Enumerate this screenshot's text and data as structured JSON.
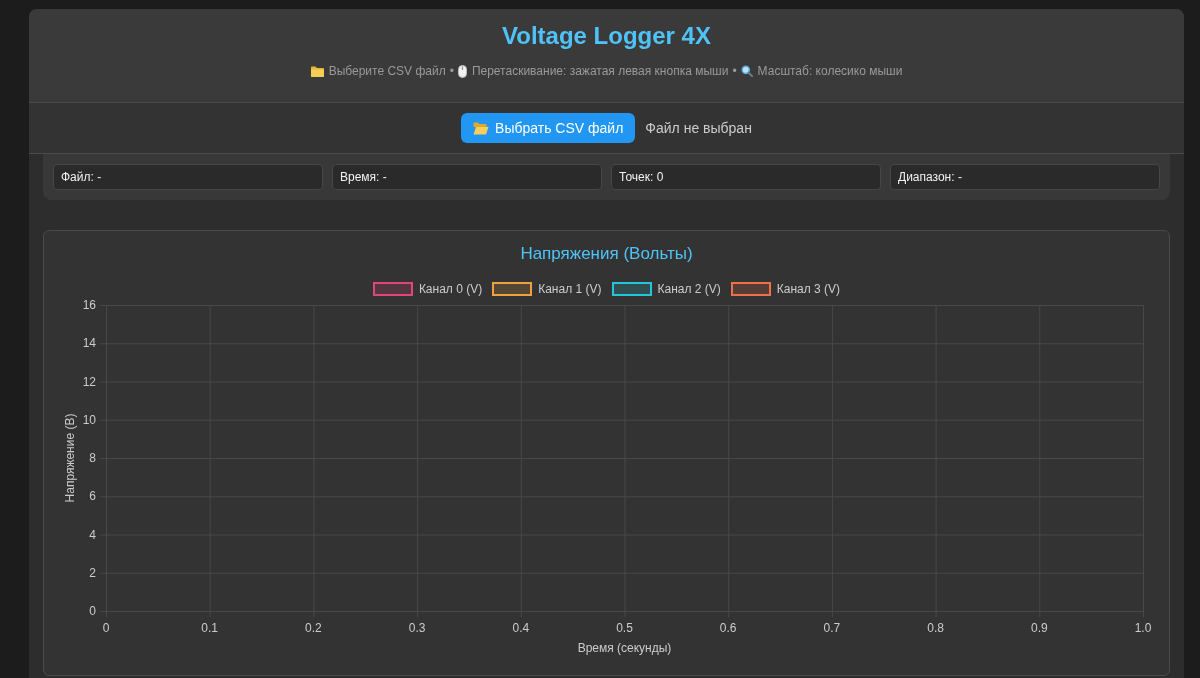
{
  "header": {
    "title": "Voltage Logger 4X",
    "hints": [
      {
        "kind": "folder",
        "text": "Выберите CSV файл"
      },
      {
        "kind": "separator",
        "text": "•"
      },
      {
        "kind": "mouse",
        "text": "Перетаскивание: зажатая левая кнопка мыши"
      },
      {
        "kind": "separator",
        "text": "•"
      },
      {
        "kind": "search",
        "text": "Масштаб: колесико мыши"
      }
    ]
  },
  "file_picker": {
    "button": "Выбрать CSV файл",
    "status": "Файл не выбран"
  },
  "stats": [
    {
      "text": "Файл: -"
    },
    {
      "text": "Время: -"
    },
    {
      "text": "Точек: 0"
    },
    {
      "text": "Диапазон: -"
    }
  ],
  "chart": {
    "chart_data": [
      {
        "type": "line",
        "title": "Напряжения (Вольты)",
        "xlabel": "Время (секунды)",
        "ylabel": "Напряжение (В)",
        "categories": [
          "0",
          "0.1",
          "0.2",
          "0.3",
          "0.4",
          "0.5",
          "0.6",
          "0.7",
          "0.8",
          "0.9",
          "1.0"
        ],
        "ylim": [
          0,
          16
        ],
        "yticks": [
          0,
          2,
          4,
          6,
          8,
          10,
          12,
          14,
          16
        ],
        "grid": true,
        "legend": "top",
        "series": [
          {
            "name": "Канал 0 (V)",
            "color": "#e0457b",
            "values": [
              null,
              null,
              null,
              null,
              null,
              null,
              null,
              null,
              null,
              null,
              null
            ]
          },
          {
            "name": "Канал 1 (V)",
            "color": "#f0a040",
            "values": [
              null,
              null,
              null,
              null,
              null,
              null,
              null,
              null,
              null,
              null,
              null
            ]
          },
          {
            "name": "Канал 2 (V)",
            "color": "#26c6da",
            "values": [
              null,
              null,
              null,
              null,
              null,
              null,
              null,
              null,
              null,
              null,
              null
            ]
          },
          {
            "name": "Канал 3 (V)",
            "color": "#f07048",
            "values": [
              null,
              null,
              null,
              null,
              null,
              null,
              null,
              null,
              null,
              null,
              null
            ]
          }
        ]
      }
    ]
  }
}
